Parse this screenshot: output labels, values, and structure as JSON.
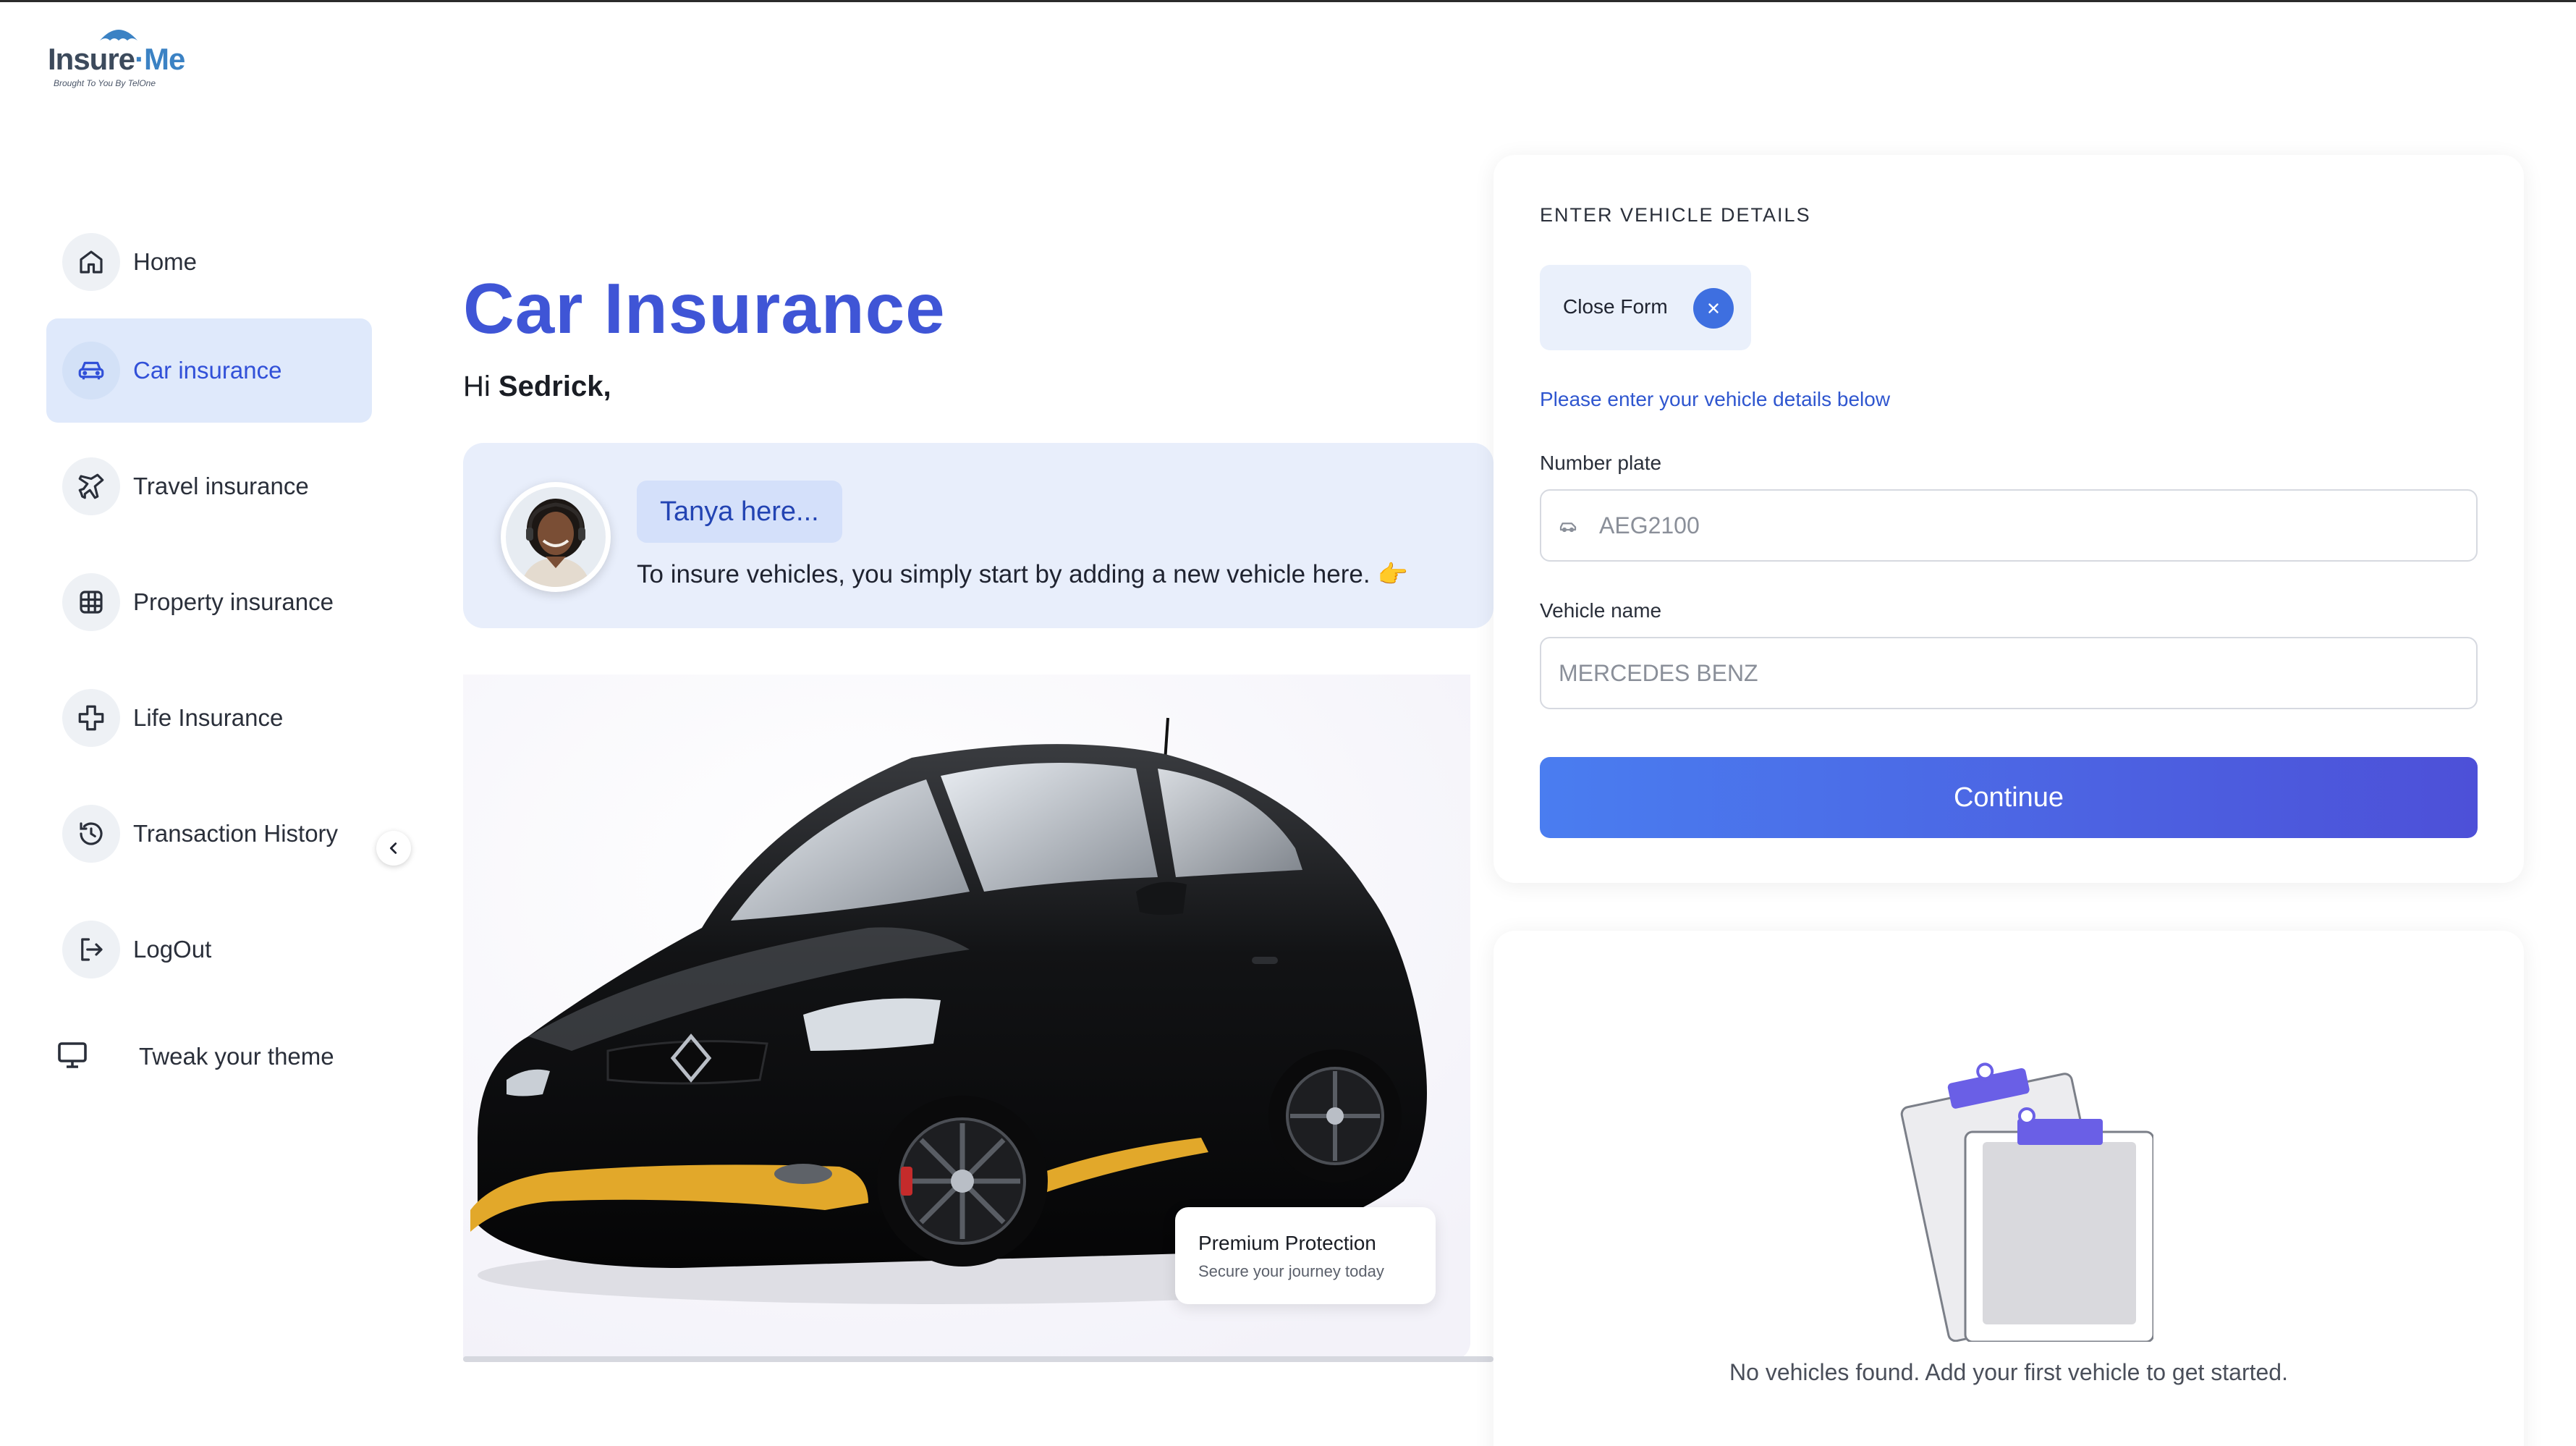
{
  "brand": {
    "logo_name_part1": "Insure",
    "logo_name_part2": "Me",
    "logo_tagline": "Brought To You By TelOne"
  },
  "sidebar": {
    "items": [
      {
        "label": "Home",
        "icon": "home-icon",
        "active": false
      },
      {
        "label": "Car insurance",
        "icon": "car-icon",
        "active": true
      },
      {
        "label": "Travel insurance",
        "icon": "plane-icon",
        "active": false
      },
      {
        "label": "Property insurance",
        "icon": "building-icon",
        "active": false
      },
      {
        "label": "Life Insurance",
        "icon": "health-cross-icon",
        "active": false
      },
      {
        "label": "Transaction History",
        "icon": "history-icon",
        "active": false
      },
      {
        "label": "LogOut",
        "icon": "logout-icon",
        "active": false
      }
    ],
    "theme_label": "Tweak your theme",
    "theme_icon": "monitor-icon",
    "collapse_icon": "chevron-left-icon"
  },
  "main": {
    "title": "Car Insurance",
    "greeting_prefix": "Hi",
    "user_name": "Sedrick,",
    "assistant": {
      "name_label": "Tanya here...",
      "message": "To insure vehicles, you simply start by adding a new vehicle here.",
      "message_emoji": "👉"
    },
    "promo": {
      "title": "Premium Protection",
      "subtitle": "Secure your journey today"
    }
  },
  "form": {
    "heading": "ENTER VEHICLE DETAILS",
    "close_label": "Close Form",
    "hint": "Please enter your vehicle details below",
    "number_plate": {
      "label": "Number plate",
      "placeholder": "AEG2100",
      "value": ""
    },
    "vehicle_name": {
      "label": "Vehicle name",
      "placeholder": "MERCEDES BENZ",
      "value": ""
    },
    "continue_label": "Continue"
  },
  "vehicles": {
    "empty_message": "No vehicles found. Add your first vehicle to get started."
  },
  "colors": {
    "accent": "#3f55d6",
    "active_nav_bg": "#dfe9fb",
    "button_gradient_start": "#4a7df0",
    "button_gradient_end": "#4d50d8",
    "clipboard_clip": "#6a5fe6"
  }
}
